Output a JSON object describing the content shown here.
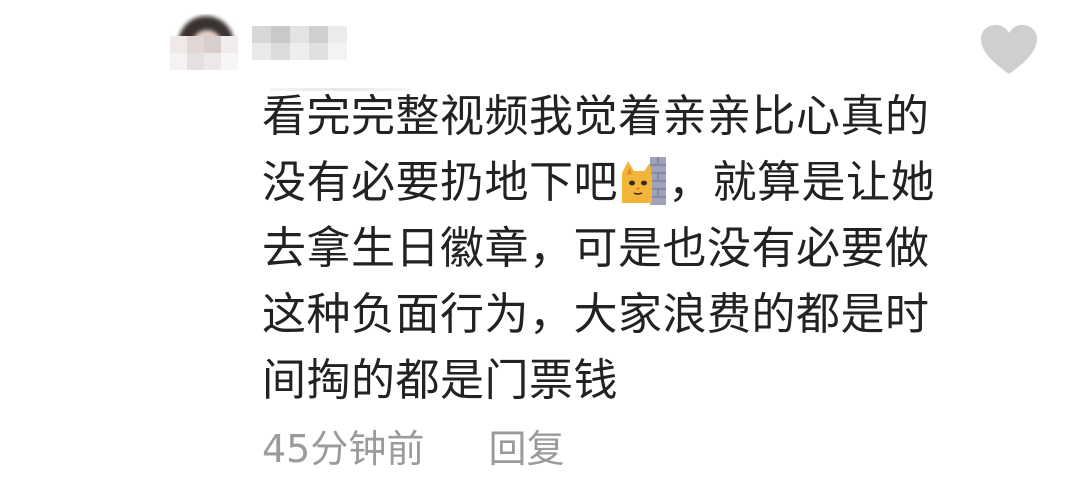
{
  "comment": {
    "lines": {
      "l1": "看完完整视频我觉着亲亲比心真的",
      "l2a": "没有必要扔地下吧",
      "l2b": "，就算是让她",
      "l3": "去拿生日徽章，可是也没有必要做",
      "l4": "这种负面行为，大家浪费的都是时",
      "l5": "间掏的都是门票钱"
    },
    "emoji": "cat-behind-wall-emoji",
    "time_ago": "45分钟前",
    "reply_label": "回复"
  },
  "icons": {
    "like": "heart-icon"
  },
  "colors": {
    "text": "#222222",
    "meta": "#9b9b9b",
    "heart": "#cfcfcf",
    "background": "#ffffff"
  }
}
